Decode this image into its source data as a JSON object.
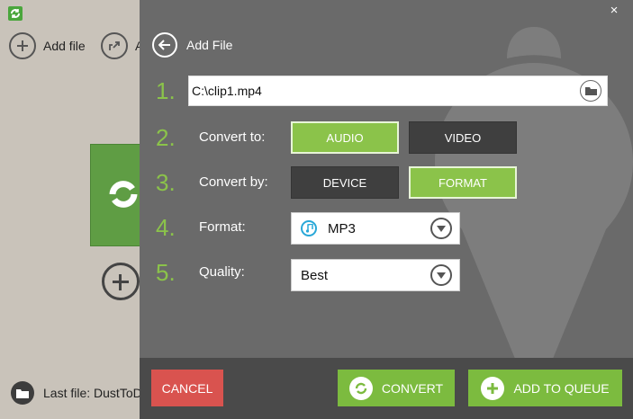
{
  "background_app": {
    "toolbar": {
      "add_file_label": "Add file",
      "second_label": "A"
    },
    "status": {
      "last_file_label": "Last file: DustToD"
    }
  },
  "panel": {
    "close_glyph": "×",
    "back_label": "Add File",
    "steps": [
      "1.",
      "2.",
      "3.",
      "4.",
      "5."
    ],
    "file_path": "C:\\clip1.mp4",
    "convert_to": {
      "label": "Convert to:",
      "options": [
        "AUDIO",
        "VIDEO"
      ],
      "selected": "AUDIO"
    },
    "convert_by": {
      "label": "Convert by:",
      "options": [
        "DEVICE",
        "FORMAT"
      ],
      "selected": "FORMAT"
    },
    "format": {
      "label": "Format:",
      "value": "MP3",
      "icon": "music-note-icon"
    },
    "quality": {
      "label": "Quality:",
      "value": "Best"
    },
    "footer": {
      "cancel_label": "CANCEL",
      "convert_label": "CONVERT",
      "add_queue_label": "ADD TO QUEUE"
    }
  },
  "colors": {
    "accent_green": "#8bc34a",
    "button_green": "#7cbb3f",
    "cancel_red": "#d9534f",
    "panel_gray": "#6a6a6a",
    "footer_gray": "#4a4a4a"
  }
}
